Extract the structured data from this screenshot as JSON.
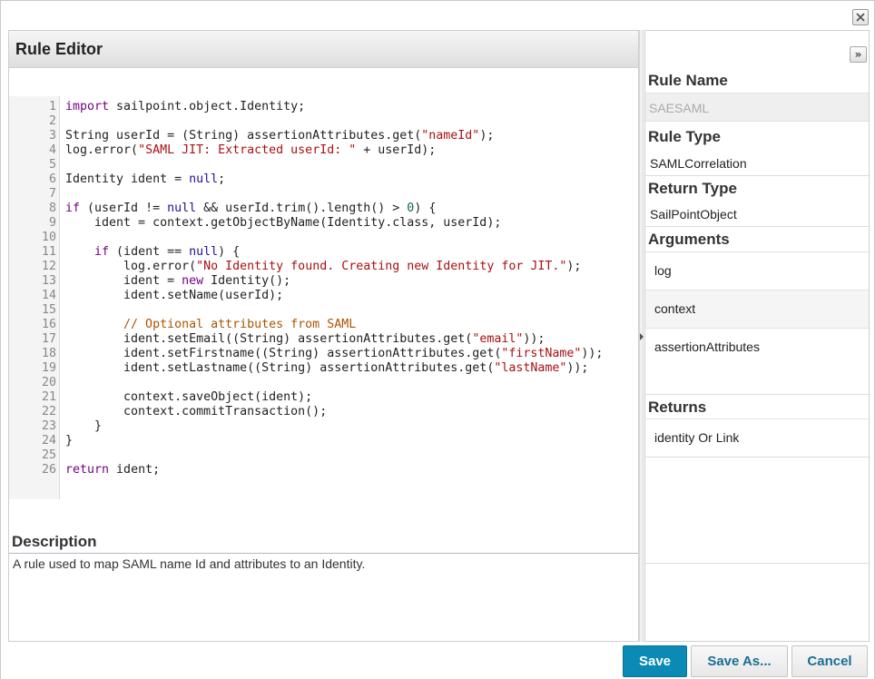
{
  "editor": {
    "title": "Rule Editor",
    "code_lines": [
      {
        "n": "1",
        "tokens": [
          {
            "t": "import",
            "c": "kw"
          },
          {
            "t": " sailpoint.object.Identity;",
            "c": ""
          }
        ]
      },
      {
        "n": "2",
        "tokens": []
      },
      {
        "n": "3",
        "tokens": [
          {
            "t": "String userId = (String) assertionAttributes.get(",
            "c": ""
          },
          {
            "t": "\"nameId\"",
            "c": "str"
          },
          {
            "t": ");",
            "c": ""
          }
        ]
      },
      {
        "n": "4",
        "tokens": [
          {
            "t": "log.error(",
            "c": ""
          },
          {
            "t": "\"SAML JIT: Extracted userId: \"",
            "c": "str"
          },
          {
            "t": " + userId);",
            "c": ""
          }
        ]
      },
      {
        "n": "5",
        "tokens": []
      },
      {
        "n": "6",
        "tokens": [
          {
            "t": "Identity ident = ",
            "c": ""
          },
          {
            "t": "null",
            "c": "atom"
          },
          {
            "t": ";",
            "c": ""
          }
        ]
      },
      {
        "n": "7",
        "tokens": []
      },
      {
        "n": "8",
        "tokens": [
          {
            "t": "if",
            "c": "kw"
          },
          {
            "t": " (userId != ",
            "c": ""
          },
          {
            "t": "null",
            "c": "atom"
          },
          {
            "t": " && userId.trim().length() > ",
            "c": ""
          },
          {
            "t": "0",
            "c": "num"
          },
          {
            "t": ") {",
            "c": ""
          }
        ]
      },
      {
        "n": "9",
        "tokens": [
          {
            "t": "    ident = context.getObjectByName(Identity.class, userId);",
            "c": ""
          }
        ]
      },
      {
        "n": "10",
        "tokens": []
      },
      {
        "n": "11",
        "tokens": [
          {
            "t": "    ",
            "c": ""
          },
          {
            "t": "if",
            "c": "kw"
          },
          {
            "t": " (ident == ",
            "c": ""
          },
          {
            "t": "null",
            "c": "atom"
          },
          {
            "t": ") {",
            "c": ""
          }
        ]
      },
      {
        "n": "12",
        "tokens": [
          {
            "t": "        log.error(",
            "c": ""
          },
          {
            "t": "\"No Identity found. Creating new Identity for JIT.\"",
            "c": "str"
          },
          {
            "t": ");",
            "c": ""
          }
        ]
      },
      {
        "n": "13",
        "tokens": [
          {
            "t": "        ident = ",
            "c": ""
          },
          {
            "t": "new",
            "c": "kw"
          },
          {
            "t": " Identity();",
            "c": ""
          }
        ]
      },
      {
        "n": "14",
        "tokens": [
          {
            "t": "        ident.setName(userId);",
            "c": ""
          }
        ]
      },
      {
        "n": "15",
        "tokens": []
      },
      {
        "n": "16",
        "tokens": [
          {
            "t": "        // Optional attributes from SAML",
            "c": "com"
          }
        ]
      },
      {
        "n": "17",
        "tokens": [
          {
            "t": "        ident.setEmail((String) assertionAttributes.get(",
            "c": ""
          },
          {
            "t": "\"email\"",
            "c": "str"
          },
          {
            "t": "));",
            "c": ""
          }
        ]
      },
      {
        "n": "18",
        "tokens": [
          {
            "t": "        ident.setFirstname((String) assertionAttributes.get(",
            "c": ""
          },
          {
            "t": "\"firstName\"",
            "c": "str"
          },
          {
            "t": "));",
            "c": ""
          }
        ]
      },
      {
        "n": "19",
        "tokens": [
          {
            "t": "        ident.setLastname((String) assertionAttributes.get(",
            "c": ""
          },
          {
            "t": "\"lastName\"",
            "c": "str"
          },
          {
            "t": "));",
            "c": ""
          }
        ]
      },
      {
        "n": "20",
        "tokens": []
      },
      {
        "n": "21",
        "tokens": [
          {
            "t": "        context.saveObject(ident);",
            "c": ""
          }
        ]
      },
      {
        "n": "22",
        "tokens": [
          {
            "t": "        context.commitTransaction();",
            "c": ""
          }
        ]
      },
      {
        "n": "23",
        "tokens": [
          {
            "t": "    }",
            "c": ""
          }
        ]
      },
      {
        "n": "24",
        "tokens": [
          {
            "t": "}",
            "c": ""
          }
        ]
      },
      {
        "n": "25",
        "tokens": []
      },
      {
        "n": "26",
        "tokens": [
          {
            "t": "return",
            "c": "kw"
          },
          {
            "t": " ident;",
            "c": ""
          }
        ]
      }
    ]
  },
  "description": {
    "label": "Description",
    "text": "A rule used to map SAML name Id and attributes to an Identity."
  },
  "sidebar": {
    "rule_name_label": "Rule Name",
    "rule_name_value": "SAESAML",
    "rule_type_label": "Rule Type",
    "rule_type_value": "SAMLCorrelation",
    "return_type_label": "Return Type",
    "return_type_value": "SailPointObject",
    "arguments_label": "Arguments",
    "arguments": [
      "log",
      "context",
      "assertionAttributes"
    ],
    "returns_label": "Returns",
    "returns": [
      "identity Or Link"
    ],
    "collapse_glyph": "»"
  },
  "footer": {
    "save_label": "Save",
    "save_as_label": "Save As...",
    "cancel_label": "Cancel"
  },
  "colors": {
    "primary_button": "#0a8ab5",
    "secondary_button_text": "#1a6e93",
    "keyword": "#770088",
    "string": "#aa1111",
    "atom": "#221199",
    "number": "#116644",
    "comment": "#aa5500"
  },
  "icons": {
    "close": "close-icon",
    "collapse": "double-chevron-right-icon",
    "splitter": "triangle-right-icon"
  }
}
